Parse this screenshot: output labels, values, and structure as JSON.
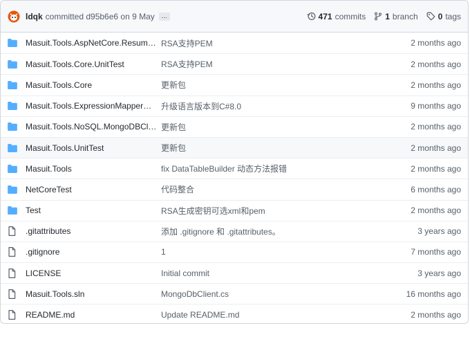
{
  "commit": {
    "author": "ldqk",
    "text": "committed d95b6e6 on 9 May",
    "more_label": "…",
    "commits_count": "471",
    "commits_label": "commits",
    "branch_count": "1",
    "branch_label": "branch",
    "tags_count": "0",
    "tags_label": "tags"
  },
  "files": [
    {
      "type": "dir",
      "name": "Masuit.Tools.AspNetCore.ResumeFile...",
      "message": "RSA支持PEM",
      "age": "2 months ago"
    },
    {
      "type": "dir",
      "name": "Masuit.Tools.Core.UnitTest",
      "message": "RSA支持PEM",
      "age": "2 months ago"
    },
    {
      "type": "dir",
      "name": "Masuit.Tools.Core",
      "message": "更新包",
      "age": "2 months ago"
    },
    {
      "type": "dir",
      "name": "Masuit.Tools.ExpressionMapperBenchm...",
      "message": "升级语言版本到C#8.0",
      "age": "9 months ago"
    },
    {
      "type": "dir",
      "name": "Masuit.Tools.NoSQL.MongoDBClient...",
      "message": "更新包",
      "age": "2 months ago"
    },
    {
      "type": "dir",
      "name": "Masuit.Tools.UnitTest",
      "message": "更新包",
      "age": "2 months ago"
    },
    {
      "type": "dir",
      "name": "Masuit.Tools",
      "message": "fix DataTableBuilder 动态方法报错",
      "age": "2 months ago"
    },
    {
      "type": "dir",
      "name": "NetCoreTest",
      "message": "代码整合",
      "age": "6 months ago"
    },
    {
      "type": "dir",
      "name": "Test",
      "message": "RSA生成密钥可选xml和pem",
      "age": "2 months ago"
    },
    {
      "type": "file",
      "name": ".gitattributes",
      "message": "添加 .gitignore 和 .gitattributes。",
      "age": "3 years ago"
    },
    {
      "type": "file",
      "name": ".gitignore",
      "message": "1",
      "age": "7 months ago"
    },
    {
      "type": "file",
      "name": "LICENSE",
      "message": "Initial commit",
      "age": "3 years ago"
    },
    {
      "type": "file",
      "name": "Masuit.Tools.sln",
      "message": "MongoDbClient.cs",
      "age": "16 months ago"
    },
    {
      "type": "file",
      "name": "README.md",
      "message": "Update README.md",
      "age": "2 months ago"
    }
  ],
  "colors": {
    "folder": "#54aeff",
    "file_icon": "#57606a",
    "header_bg": "#f6f8fa",
    "border": "#d0d7de"
  },
  "icons": {
    "avatar": "octocat-avatar-icon",
    "history": "history-icon",
    "branch": "git-branch-icon",
    "tag": "tag-icon",
    "dir": "folder-icon",
    "file": "file-icon"
  }
}
